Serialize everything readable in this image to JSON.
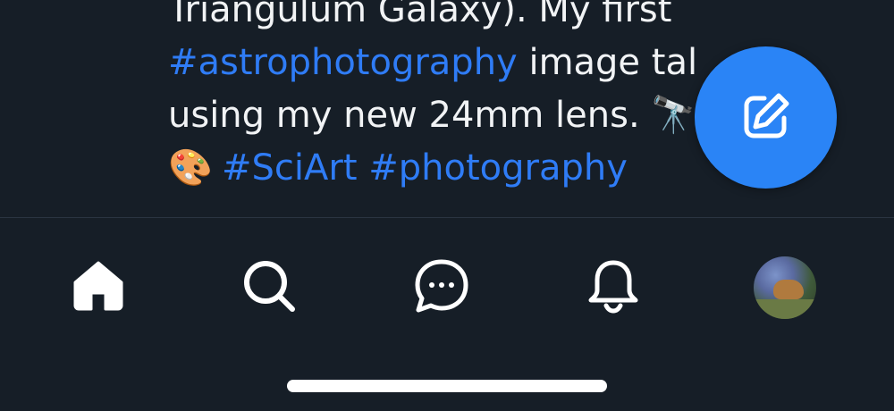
{
  "post": {
    "line1": "Triangulum Galaxy). My first",
    "line2_tag": "#astrophotography",
    "line2_text": " image tal",
    "line3_text": "using my new 24mm lens. 🔭",
    "line4_emoji": "🎨",
    "line4_tag1": "#SciArt",
    "line4_tag2": "#photography"
  },
  "fab": {
    "icon": "compose-icon",
    "color": "#2a84f6"
  },
  "tabbar": {
    "items": [
      {
        "name": "home",
        "icon": "home-icon"
      },
      {
        "name": "search",
        "icon": "search-icon"
      },
      {
        "name": "messages",
        "icon": "chat-bubble-icon"
      },
      {
        "name": "notifications",
        "icon": "bell-icon"
      },
      {
        "name": "profile",
        "icon": "avatar"
      }
    ]
  },
  "colors": {
    "background": "#161e27",
    "link": "#2f7cf6",
    "text": "#f1f3f5"
  }
}
